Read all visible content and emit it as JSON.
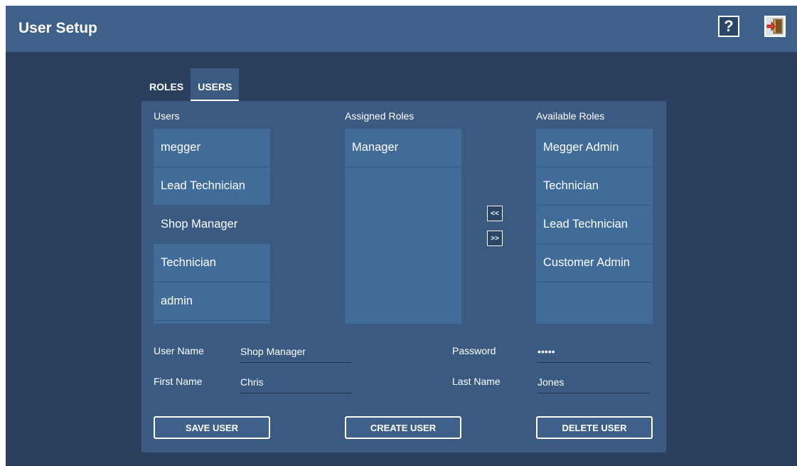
{
  "header": {
    "title": "User Setup",
    "help_label": "?",
    "icons": [
      "help-icon",
      "exit-door-icon"
    ]
  },
  "tabs": [
    {
      "label": "ROLES",
      "active": false
    },
    {
      "label": "USERS",
      "active": true
    }
  ],
  "columns": {
    "users_label": "Users",
    "assigned_label": "Assigned Roles",
    "available_label": "Available Roles"
  },
  "users": [
    "megger",
    "Lead Technician",
    "Shop Manager",
    "Technician",
    "admin"
  ],
  "selected_user": "Shop Manager",
  "assigned_roles": [
    "Manager"
  ],
  "available_roles": [
    "Megger Admin",
    "Technician",
    "Lead Technician",
    "Customer Admin"
  ],
  "move": {
    "left_label": "<<",
    "right_label": ">>"
  },
  "form": {
    "username_label": "User Name",
    "username_value": "Shop Manager",
    "password_label": "Password",
    "password_value": "•••••",
    "firstname_label": "First Name",
    "firstname_value": "Chris",
    "lastname_label": "Last Name",
    "lastname_value": "Jones"
  },
  "buttons": {
    "save": "SAVE USER",
    "create": "CREATE USER",
    "delete": "DELETE USER"
  },
  "colors": {
    "header_bg": "#3e6089",
    "window_bg": "#2b3f5e",
    "panel_bg": "#3b5a82",
    "list_bg": "#416b98"
  }
}
